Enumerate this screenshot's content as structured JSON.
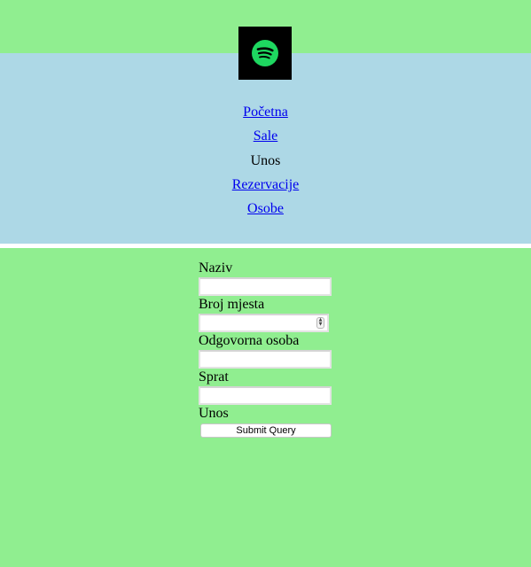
{
  "logo": {
    "icon": "spotify-logo",
    "brand_color": "#1ed760",
    "background": "#000000"
  },
  "nav": {
    "items": [
      {
        "label": "Početna",
        "link": true
      },
      {
        "label": "Sale",
        "link": true
      },
      {
        "label": "Unos",
        "link": false
      },
      {
        "label": "Rezervacije",
        "link": true
      },
      {
        "label": "Osobe",
        "link": true
      }
    ]
  },
  "form": {
    "naziv_label": "Naziv",
    "naziv_value": "",
    "broj_mjesta_label": "Broj mjesta",
    "broj_mjesta_value": "",
    "odgovorna_osoba_label": "Odgovorna osoba",
    "odgovorna_osoba_value": "",
    "sprat_label": "Sprat",
    "sprat_value": "",
    "unos_label": "Unos",
    "submit_label": "Submit Query"
  },
  "colors": {
    "page_background": "#90ee90",
    "nav_background": "#add8e6",
    "link": "#0000ee"
  }
}
